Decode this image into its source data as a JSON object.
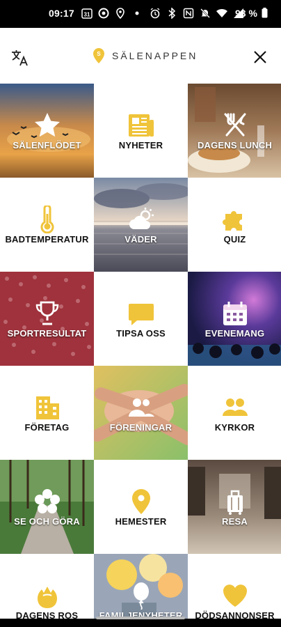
{
  "status_bar": {
    "time": "09:17",
    "battery": "93 %",
    "left_icons": [
      "calendar-31-icon",
      "circle-icon",
      "location-icon",
      "dot-icon"
    ],
    "right_icons": [
      "alarm-icon",
      "bluetooth-icon",
      "nfc-icon",
      "mute-icon",
      "wifi-icon",
      "signal-icon",
      "battery-icon"
    ]
  },
  "header": {
    "app_name": "SÄLENAPPEN",
    "brand_color": "#f0c43a"
  },
  "tiles": [
    {
      "label": "SÄLENFLÖDET",
      "icon": "star-icon",
      "style": "photo"
    },
    {
      "label": "NYHETER",
      "icon": "newspaper-icon",
      "style": "light"
    },
    {
      "label": "DAGENS LUNCH",
      "icon": "fork-knife-icon",
      "style": "photo"
    },
    {
      "label": "BADTEMPERATUR",
      "icon": "thermometer-icon",
      "style": "light"
    },
    {
      "label": "VÄDER",
      "icon": "weather-icon",
      "style": "photo"
    },
    {
      "label": "QUIZ",
      "icon": "puzzle-icon",
      "style": "light"
    },
    {
      "label": "SPORTRESULTAT",
      "icon": "trophy-icon",
      "style": "photo"
    },
    {
      "label": "TIPSA OSS",
      "icon": "chat-icon",
      "style": "light"
    },
    {
      "label": "EVENEMANG",
      "icon": "calendar-icon",
      "style": "photo"
    },
    {
      "label": "FÖRETAG",
      "icon": "building-icon",
      "style": "light"
    },
    {
      "label": "FÖRENINGAR",
      "icon": "group-icon",
      "style": "photo"
    },
    {
      "label": "KYRKOR",
      "icon": "people-icon",
      "style": "light"
    },
    {
      "label": "SE OCH GÖRA",
      "icon": "flower-icon",
      "style": "photo"
    },
    {
      "label": "HEMESTER",
      "icon": "map-pin-icon",
      "style": "light"
    },
    {
      "label": "RESA",
      "icon": "suitcase-icon",
      "style": "photo"
    },
    {
      "label": "DAGENS ROS",
      "icon": "rose-icon",
      "style": "light"
    },
    {
      "label": "FAMILJENYHETER",
      "icon": "balloon-icon",
      "style": "photo"
    },
    {
      "label": "DÖDSANNONSER",
      "icon": "heart-icon",
      "style": "light"
    }
  ]
}
